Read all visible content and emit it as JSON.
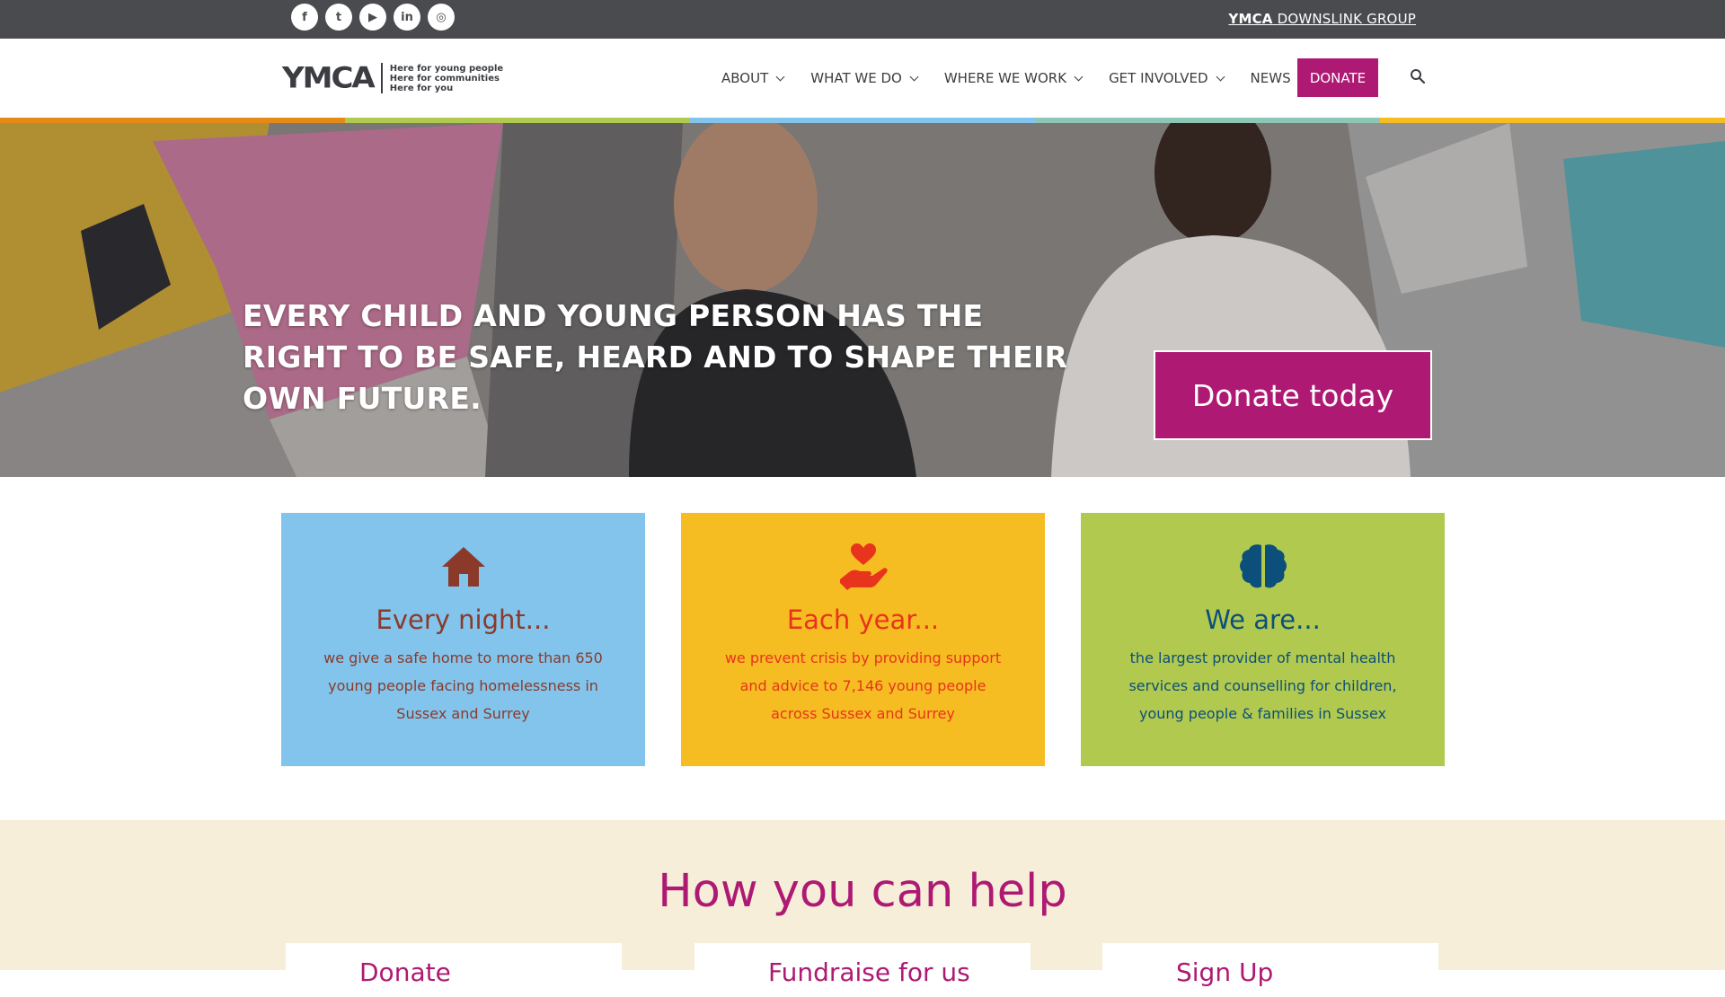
{
  "topbar": {
    "social_icons": [
      "facebook-icon",
      "twitter-icon",
      "youtube-icon",
      "linkedin-icon",
      "instagram-icon"
    ],
    "social_glyphs": [
      "f",
      "t",
      "▶",
      "in",
      "◎"
    ],
    "group_link_bold": "YMCA",
    "group_link_rest": "DOWNSLINK GROUP"
  },
  "header": {
    "logo_text": "YMCA",
    "logo_tagline": [
      "Here for young people",
      "Here for communities",
      "Here for you"
    ],
    "nav": [
      {
        "label": "ABOUT"
      },
      {
        "label": "WHAT WE DO"
      },
      {
        "label": "WHERE WE WORK"
      },
      {
        "label": "GET INVOLVED"
      },
      {
        "label": "NEWS"
      }
    ],
    "donate_label": "DONATE"
  },
  "hero": {
    "title": "EVERY CHILD AND YOUNG PERSON HAS THE RIGHT TO BE SAFE, HEARD AND TO SHAPE THEIR OWN FUTURE.",
    "donate_label": "Donate today"
  },
  "cards": [
    {
      "icon": "house-icon",
      "title": "Every night...",
      "text": "we give a safe home to more than 650 young people facing homelessness in Sussex and Surrey",
      "bg": "#82c4ec",
      "fg": "#8b3a2a"
    },
    {
      "icon": "heart-hand-icon",
      "title": "Each year...",
      "text": "we prevent crisis by providing support and advice to 7,146 young people across Sussex and Surrey",
      "bg": "#f6bd22",
      "fg": "#e8341c"
    },
    {
      "icon": "brain-icon",
      "title": "We are...",
      "text": "the largest provider of mental health services and counselling for children, young people & families in Sussex",
      "bg": "#b1c94e",
      "fg": "#0d4f7b"
    }
  ],
  "help": {
    "title": "How you can help",
    "cards": [
      "Donate",
      "Fundraise for us",
      "Sign Up"
    ]
  },
  "colors": {
    "brand": "#ae1973",
    "topbar": "#4a4b4f",
    "stripe": [
      "#e58a17",
      "#b1c94e",
      "#82c4ec",
      "#8ec6b6",
      "#f6bd22"
    ]
  }
}
